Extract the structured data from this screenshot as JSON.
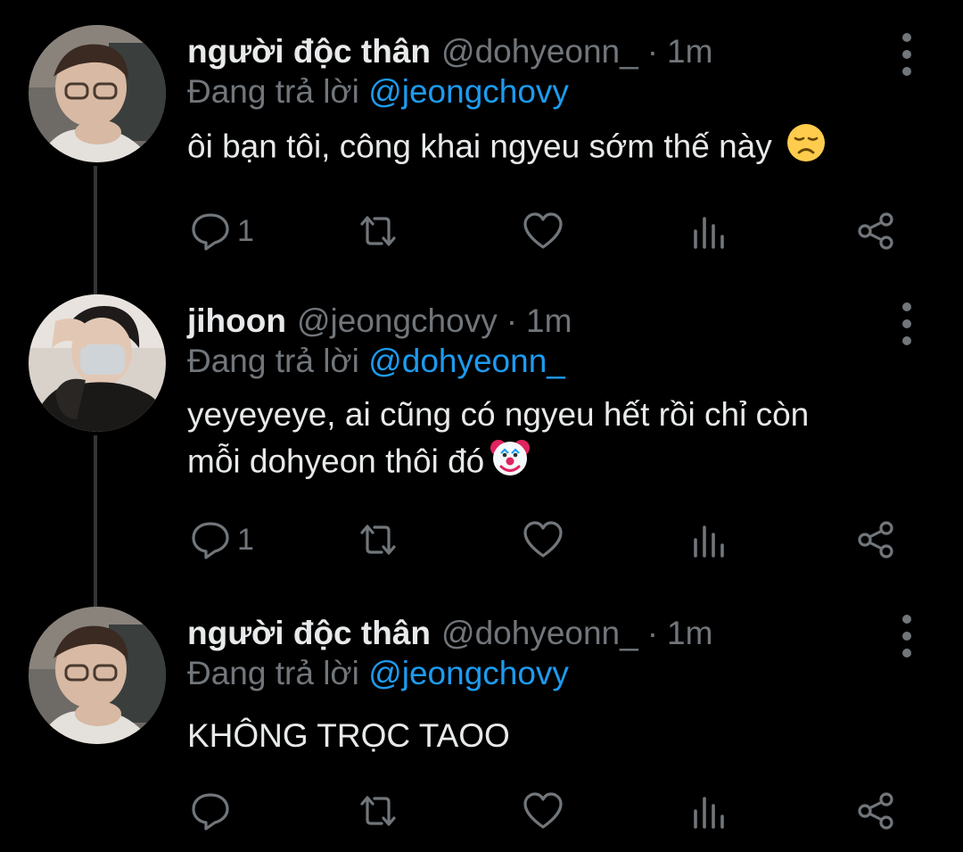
{
  "colors": {
    "background": "#000000",
    "text": "#e7e9ea",
    "muted": "#71767b",
    "mention": "#1d9bf0",
    "thread_line": "#333639"
  },
  "tweets": [
    {
      "display_name": "người độc thân",
      "handle": "@dohyeonn_",
      "separator": "·",
      "time": "1m",
      "replying_prefix": "Đang trả lời",
      "replying_to": "@jeongchovy",
      "text": "ôi bạn tôi, công khai ngyeu sớm thế này",
      "emoji": "disappointed-face",
      "reply_count": "1"
    },
    {
      "display_name": "jihoon",
      "handle": "@jeongchovy",
      "separator": "·",
      "time": "1m",
      "replying_prefix": "Đang trả lời",
      "replying_to": "@dohyeonn_",
      "text_line1": "yeyeyeye, ai cũng có ngyeu hết rồi chỉ còn",
      "text_line2": "mỗi dohyeon thôi đó",
      "emoji": "clown-face",
      "reply_count": "1"
    },
    {
      "display_name": "người độc thân",
      "handle": "@dohyeonn_",
      "separator": "·",
      "time": "1m",
      "replying_prefix": "Đang trả lời",
      "replying_to": "@jeongchovy",
      "text": "KHÔNG TRỌC TAOO",
      "reply_count": ""
    }
  ],
  "icons": [
    "reply-icon",
    "retweet-icon",
    "like-icon",
    "views-icon",
    "share-icon",
    "more-icon"
  ]
}
